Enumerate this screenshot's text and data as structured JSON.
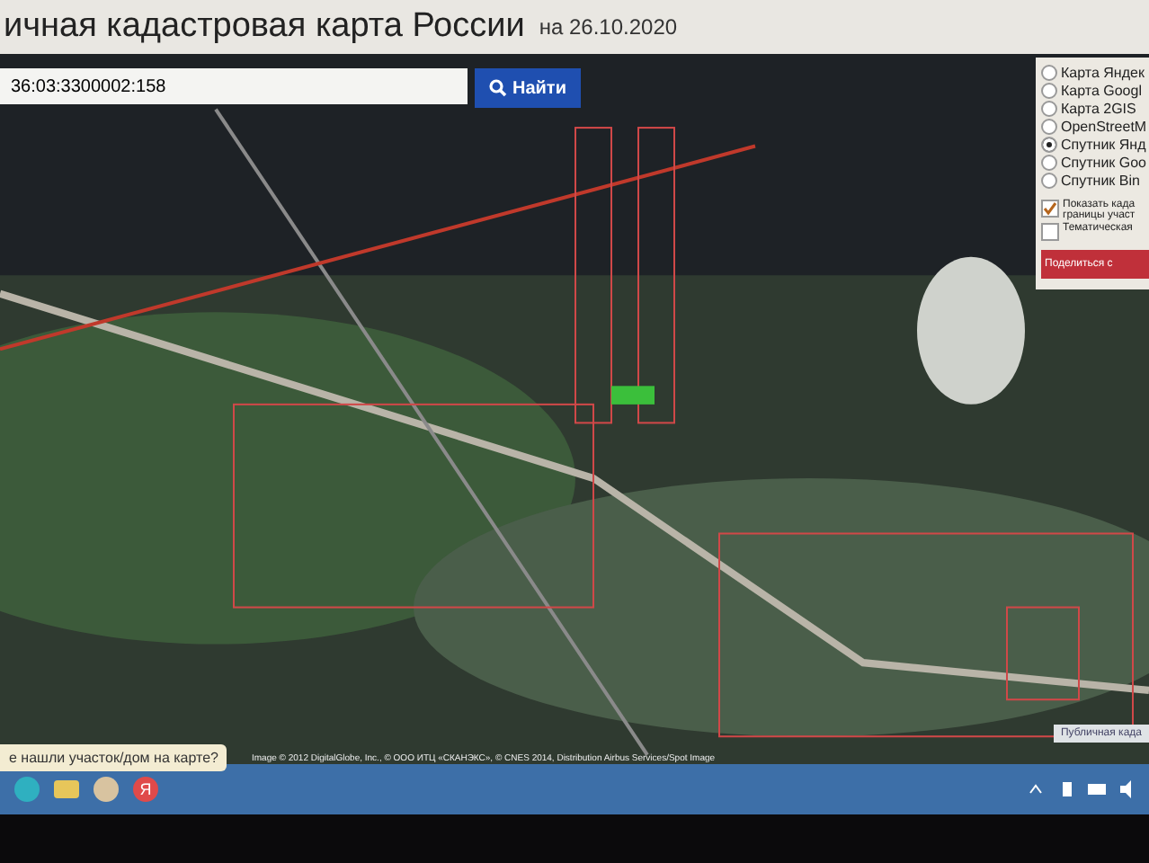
{
  "header": {
    "title": "ичная кадастровая карта России",
    "date": "на 26.10.2020"
  },
  "search": {
    "value": "36:03:3300002:158",
    "button": "Найти"
  },
  "layers": {
    "options": [
      {
        "label": "Карта Яндек",
        "selected": false
      },
      {
        "label": "Карта Googl",
        "selected": false
      },
      {
        "label": "Карта 2GIS",
        "selected": false
      },
      {
        "label": "OpenStreetM",
        "selected": false
      },
      {
        "label": "Спутник Янд",
        "selected": true
      },
      {
        "label": "Спутник Goo",
        "selected": false
      },
      {
        "label": "Спутник Bin",
        "selected": false
      }
    ],
    "toggles": [
      {
        "label": "Показать када границы участ",
        "checked": true
      },
      {
        "label": "Тематическая",
        "checked": false
      }
    ],
    "share_button": "Поделиться с"
  },
  "map": {
    "attribution": "Image © 2012 DigitalGlobe, Inc., © ООО ИТЦ «СКАНЭКС», © CNES 2014, Distribution Airbus Services/Spot Image",
    "corner_label": "Публичная када",
    "help_button": "е нашли участок/дом на карте?"
  },
  "taskbar": {
    "yandex_label": "Я"
  }
}
